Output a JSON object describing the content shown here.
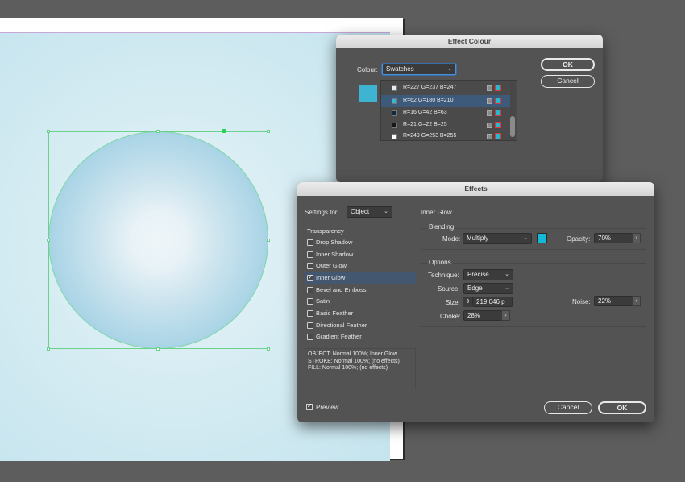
{
  "effect_colour_dialog": {
    "title": "Effect Colour",
    "colour_label": "Colour:",
    "colour_mode": "Swatches",
    "preview_color": "#3eb4d2",
    "ok_label": "OK",
    "cancel_label": "Cancel",
    "swatches": [
      {
        "name": "R=227 G=237 B=247",
        "color": "#e3edf7",
        "selected": false
      },
      {
        "name": "R=62 G=180 B=210",
        "color": "#3eb4d2",
        "selected": true
      },
      {
        "name": "R=16 G=42 B=63",
        "color": "#102a3f",
        "selected": false
      },
      {
        "name": "R=21 G=22 B=25",
        "color": "#151619",
        "selected": false
      },
      {
        "name": "R=249 G=253 B=255",
        "color": "#f9fdff",
        "selected": false
      }
    ]
  },
  "effects_dialog": {
    "title": "Effects",
    "settings_for_label": "Settings for:",
    "settings_for_value": "Object",
    "section_title": "Inner Glow",
    "effects_header": "Transparency",
    "effects_list": [
      {
        "label": "Drop Shadow",
        "checked": false,
        "selected": false
      },
      {
        "label": "Inner Shadow",
        "checked": false,
        "selected": false
      },
      {
        "label": "Outer Glow",
        "checked": false,
        "selected": false
      },
      {
        "label": "Inner Glow",
        "checked": true,
        "selected": true
      },
      {
        "label": "Bevel and Emboss",
        "checked": false,
        "selected": false
      },
      {
        "label": "Satin",
        "checked": false,
        "selected": false
      },
      {
        "label": "Basic Feather",
        "checked": false,
        "selected": false
      },
      {
        "label": "Directional Feather",
        "checked": false,
        "selected": false
      },
      {
        "label": "Gradient Feather",
        "checked": false,
        "selected": false
      }
    ],
    "summary": {
      "line1": "OBJECT: Normal 100%; Inner Glow",
      "line2": "STROKE: Normal 100%; (no effects)",
      "line3": "FILL: Normal 100%; (no effects)"
    },
    "blending": {
      "title": "Blending",
      "mode_label": "Mode:",
      "mode_value": "Multiply",
      "glow_color": "#14b9d6",
      "opacity_label": "Opacity:",
      "opacity_value": "70%"
    },
    "options": {
      "title": "Options",
      "technique_label": "Technique:",
      "technique_value": "Precise",
      "source_label": "Source:",
      "source_value": "Edge",
      "size_label": "Size:",
      "size_value": "219.046 p",
      "choke_label": "Choke:",
      "choke_value": "28%",
      "noise_label": "Noise:",
      "noise_value": "22%"
    },
    "preview_label": "Preview",
    "preview_checked": true,
    "cancel_label": "Cancel",
    "ok_label": "OK"
  }
}
